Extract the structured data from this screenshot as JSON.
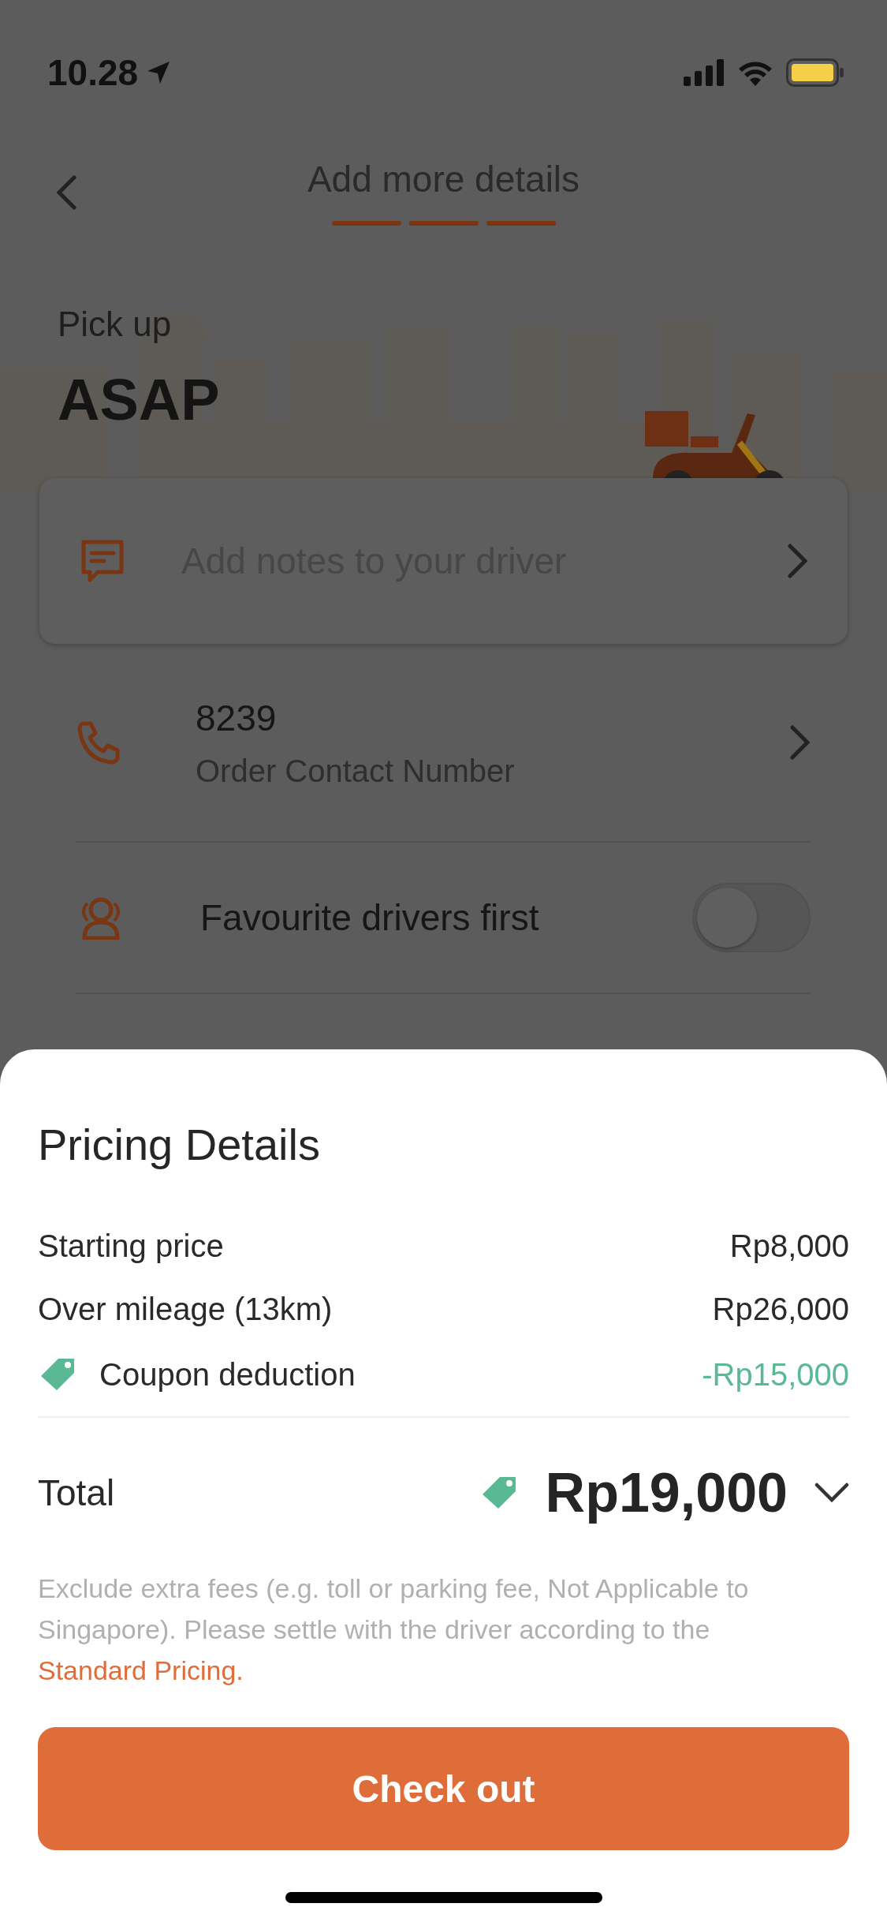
{
  "status_bar": {
    "time": "10.28"
  },
  "header": {
    "title": "Add more details",
    "steps": [
      {
        "done": true
      },
      {
        "done": true
      },
      {
        "done": true
      }
    ]
  },
  "pickup": {
    "label": "Pick up",
    "value": "ASAP"
  },
  "notes": {
    "placeholder": "Add notes to your driver"
  },
  "contact": {
    "value": "8239",
    "label": "Order Contact Number"
  },
  "favourite": {
    "label": "Favourite drivers first",
    "on": false
  },
  "pricing": {
    "title": "Pricing Details",
    "lines": [
      {
        "kind": "plain",
        "label": "Starting price",
        "amount": "Rp8,000"
      },
      {
        "kind": "plain",
        "label": "Over mileage (13km)",
        "amount": "Rp26,000"
      },
      {
        "kind": "coupon",
        "label": "Coupon deduction",
        "amount": "-Rp15,000"
      }
    ],
    "total_label": "Total",
    "total": "Rp19,000",
    "expanded": false,
    "note": "Exclude extra fees (e.g. toll or parking fee, Not Applicable to Singapore). Please settle with the driver according to the",
    "note_link": "Standard Pricing.",
    "button": "Check out"
  }
}
